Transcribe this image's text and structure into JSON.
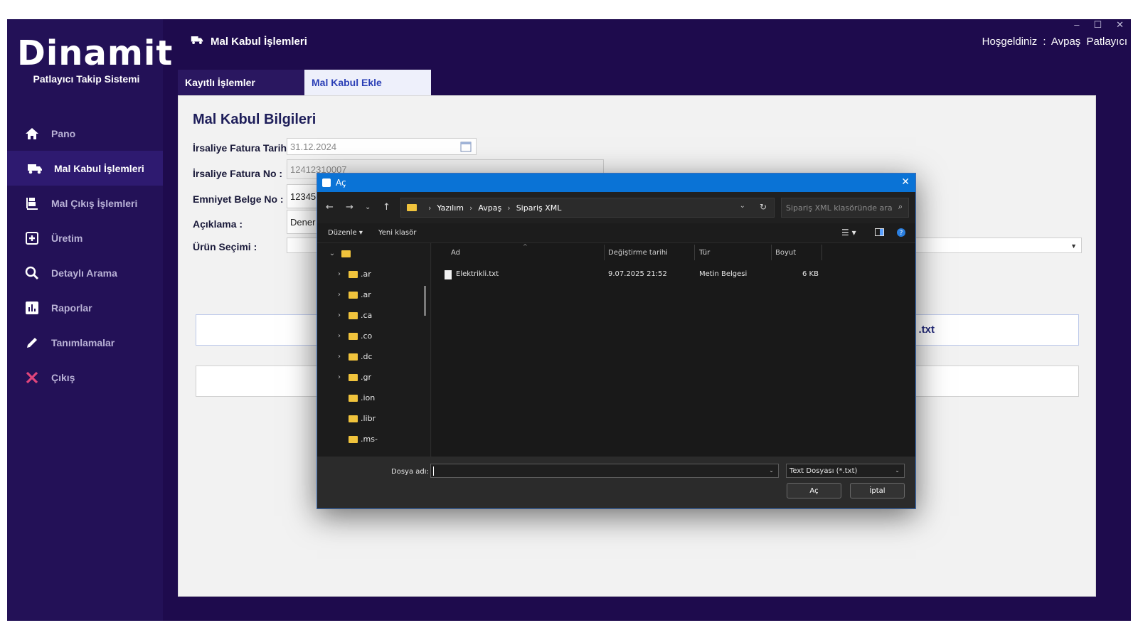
{
  "window": {
    "minimize": "–",
    "maximize": "☐",
    "close": "✕"
  },
  "sidebar": {
    "logo_text": "Dinamit",
    "logo_sub": "Patlayıcı Takip Sistemi",
    "items": [
      {
        "label": "Pano",
        "icon": "home-icon"
      },
      {
        "label": "Mal Kabul İşlemleri",
        "icon": "truck-icon"
      },
      {
        "label": "Mal Çıkış İşlemleri",
        "icon": "dolly-icon"
      },
      {
        "label": "Üretim",
        "icon": "plus-square-icon"
      },
      {
        "label": "Detaylı Arama",
        "icon": "search-icon"
      },
      {
        "label": "Raporlar",
        "icon": "chart-icon"
      },
      {
        "label": "Tanımlamalar",
        "icon": "pencil-icon"
      },
      {
        "label": "Çıkış",
        "icon": "close-icon"
      }
    ],
    "accent_exit": "#e0457b"
  },
  "header": {
    "title": "Mal Kabul İşlemleri",
    "welcome": "Hoşgeldiniz :  Avpaş  Patlayıcı"
  },
  "tabs": [
    {
      "label": "Kayıtlı İşlemler"
    },
    {
      "label": "Mal Kabul Ekle"
    }
  ],
  "form": {
    "title": "Mal Kabul Bilgileri",
    "date_label": "İrsaliye Fatura Tarihi :",
    "date_value": "31.12.2024",
    "invoice_label": "İrsaliye Fatura No :",
    "invoice_value": "12412310007",
    "security_label": "Emniyet Belge No :",
    "security_value": "12345",
    "desc_label": "Açıklama :",
    "desc_value": "Dener",
    "product_label": "Ürün Seçimi :",
    "file_box_text": ".txt"
  },
  "dialog": {
    "title": "Aç",
    "breadcrumb": [
      "Yazılım",
      "Avpaş",
      "Sipariş XML"
    ],
    "search_placeholder": "Sipariş XML klasöründe ara",
    "toolbar": {
      "organize": "Düzenle",
      "new_folder": "Yeni klasör"
    },
    "tree": [
      ".ar",
      ".ar",
      ".ca",
      ".co",
      ".dc",
      ".gr",
      ".ion",
      ".libr",
      ".ms-"
    ],
    "columns": {
      "name": "Ad",
      "modified": "Değiştirme tarihi",
      "type": "Tür",
      "size": "Boyut"
    },
    "files": [
      {
        "name": "Elektrikli.txt",
        "modified": "9.07.2025 21:52",
        "type": "Metin Belgesi",
        "size": "6 KB"
      }
    ],
    "filename_label": "Dosya adı:",
    "filename_value": "",
    "filter": "Text Dosyası (*.txt)",
    "open_button": "Aç",
    "cancel_button": "İptal"
  }
}
